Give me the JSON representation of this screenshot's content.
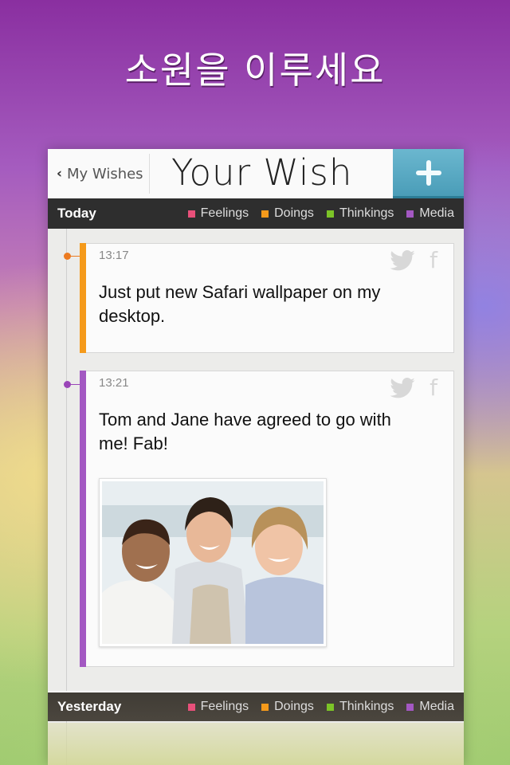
{
  "banner": "소원을 이루세요",
  "nav": {
    "back_label": "My Wishes",
    "title": "Your Wish",
    "add_label": "+"
  },
  "legend": [
    {
      "label": "Feelings",
      "color": "#e8507a"
    },
    {
      "label": "Doings",
      "color": "#f59a1b"
    },
    {
      "label": "Thinkings",
      "color": "#7cc427"
    },
    {
      "label": "Media",
      "color": "#a358c2"
    }
  ],
  "sections": {
    "today": "Today",
    "yesterday": "Yesterday"
  },
  "entries": [
    {
      "time": "13:17",
      "text": "Just put new Safari wallpaper on my desktop.",
      "category": "Doings",
      "accent": "#f59a1b",
      "dot": "#ec7a20"
    },
    {
      "time": "13:21",
      "text": "Tom and Jane have agreed to go with me! Fab!",
      "category": "Media",
      "accent": "#a358c2",
      "dot": "#9a45b8",
      "photo_alt": "Three smiling women posing together"
    }
  ]
}
